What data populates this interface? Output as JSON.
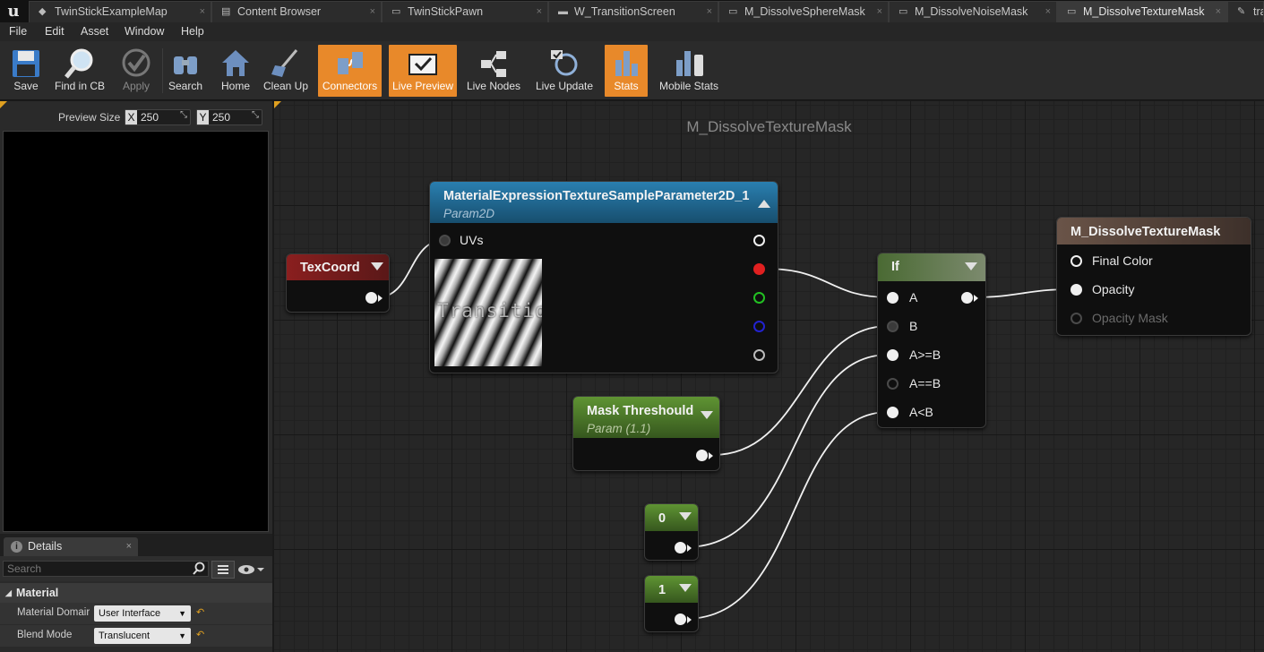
{
  "tabs": [
    {
      "label": "TwinStickExampleMap",
      "icon": "level-icon"
    },
    {
      "label": "Content Browser",
      "icon": "content-browser-icon"
    },
    {
      "label": "TwinStickPawn",
      "icon": "blueprint-icon"
    },
    {
      "label": "W_TransitionScreen",
      "icon": "widget-icon"
    },
    {
      "label": "M_DissolveSphereMask",
      "icon": "material-icon"
    },
    {
      "label": "M_DissolveNoiseMask",
      "icon": "material-icon"
    },
    {
      "label": "M_DissolveTextureMask",
      "icon": "material-icon"
    },
    {
      "label": "tra",
      "icon": "texture-icon"
    }
  ],
  "menu": [
    "File",
    "Edit",
    "Asset",
    "Window",
    "Help"
  ],
  "toolbar": {
    "save": "Save",
    "find_in_cb": "Find in CB",
    "apply": "Apply",
    "search": "Search",
    "home": "Home",
    "clean_up": "Clean Up",
    "connectors": "Connectors",
    "live_preview": "Live Preview",
    "live_nodes": "Live Nodes",
    "live_update": "Live Update",
    "stats": "Stats",
    "mobile_stats": "Mobile Stats",
    "active_color": "#e8892a"
  },
  "preview": {
    "size_label": "Preview Size",
    "x_label": "X",
    "x_value": "250",
    "y_label": "Y",
    "y_value": "250"
  },
  "details": {
    "tab_label": "Details",
    "search_placeholder": "Search",
    "section": "Material",
    "props": [
      {
        "label": "Material Domair",
        "value": "User Interface"
      },
      {
        "label": "Blend Mode",
        "value": "Translucent"
      }
    ]
  },
  "graph": {
    "title": "M_DissolveTextureMask",
    "texcoord": {
      "title": "TexCoord"
    },
    "texparam": {
      "title": "MaterialExpressionTextureSampleParameter2D_1",
      "subtitle": "Param2D",
      "input_uvs": "UVs",
      "thumb_text": "Transition"
    },
    "mask": {
      "title": "Mask Threshould",
      "subtitle": "Param (1.1)"
    },
    "const0": {
      "value": "0"
    },
    "const1": {
      "value": "1"
    },
    "if_node": {
      "title": "If",
      "pins": [
        "A",
        "B",
        "A>=B",
        "A==B",
        "A<B"
      ]
    },
    "result": {
      "title": "M_DissolveTextureMask",
      "pins": [
        "Final Color",
        "Opacity",
        "Opacity Mask"
      ]
    },
    "colors": {
      "texcoord_header": "#8a1f1f",
      "param_header": "#1e6e9e",
      "scalar_header": "#4a7a28",
      "if_header": "#506a40",
      "result_header": "#5e4b42"
    }
  }
}
